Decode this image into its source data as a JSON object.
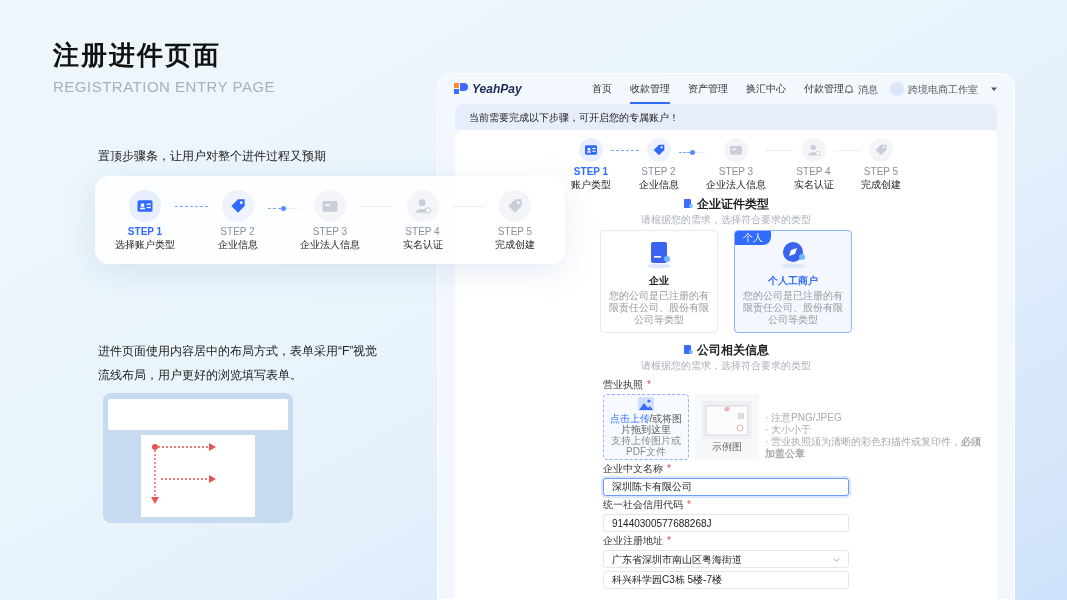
{
  "slide": {
    "title": "注册进件页面",
    "subtitle": "REGISTRATION ENTRY PAGE",
    "note_1": "置顶步骤条，让用户对整个进件过程又预期",
    "note_2": "进件页面使用内容居中的布局方式，表单采用“F”视觉流线布局，用户更好的浏览填写表单。"
  },
  "step_card": {
    "steps": [
      {
        "step": "STEP 1",
        "label": "选择账户类型",
        "kind": "current"
      },
      {
        "step": "STEP 2",
        "label": "企业信息",
        "kind": "reached"
      },
      {
        "step": "STEP 3",
        "label": "企业法人信息",
        "kind": "pending"
      },
      {
        "step": "STEP 4",
        "label": "实名认证",
        "kind": "pending"
      },
      {
        "step": "STEP 5",
        "label": "完成创建",
        "kind": "pending"
      }
    ]
  },
  "app": {
    "logo": "YeahPay",
    "nav": [
      {
        "label": "首页",
        "selected": false
      },
      {
        "label": "收款管理",
        "selected": true
      },
      {
        "label": "资产管理",
        "selected": false
      },
      {
        "label": "换汇中心",
        "selected": false
      },
      {
        "label": "付款管理",
        "selected": false
      }
    ],
    "notifications": "消息",
    "account": "跨境电商工作室",
    "banner": "当前需要完成以下步骤，可开启您的专属账户！",
    "steps": [
      {
        "step": "STEP 1",
        "label": "账户类型",
        "kind": "current"
      },
      {
        "step": "STEP 2",
        "label": "企业信息",
        "kind": "reached"
      },
      {
        "step": "STEP 3",
        "label": "企业法人信息",
        "kind": "pending"
      },
      {
        "step": "STEP 4",
        "label": "实名认证",
        "kind": "pending"
      },
      {
        "step": "STEP 5",
        "label": "完成创建",
        "kind": "pending"
      }
    ],
    "type_section": {
      "title": "企业证件类型",
      "subtitle": "请根据您的需求，选择符合要求的类型"
    },
    "types": [
      {
        "title": "企业",
        "description": "您的公司是已注册的有限责任公司、股份有限公司等类型",
        "selected": false
      },
      {
        "badge": "个人",
        "title": "个人工商户",
        "description": "您的公司是已注册的有限责任公司、股份有限公司等类型",
        "selected": true
      }
    ],
    "info_section": {
      "title": "公司相关信息",
      "subtitle": "请根据您的需求，选择符合要求的类型"
    },
    "fields": [
      {
        "kind": "upload",
        "label": "营业执照",
        "required_mark": "*",
        "upload_link": "点击上传",
        "upload_text": "/或将图片拖到这里",
        "upload_hint": "支持上传图片或PDF文件",
        "sample_caption": "示例图",
        "hints": [
          "· 注意PNG/JPEG",
          "· 大小小于",
          "· 营业执照须为清晰的彩色扫描件或复印件，**必须加盖公章**"
        ]
      },
      {
        "kind": "text",
        "label": "企业中文名称",
        "required_mark": "*",
        "value": "深圳陈卡有限公司",
        "focused": true
      },
      {
        "kind": "text",
        "label": "统一社会信用代码",
        "required_mark": "*",
        "value": "91440300577688268J",
        "focused": false
      },
      {
        "kind": "address",
        "label": "企业注册地址",
        "required_mark": "*",
        "region": "广东省深圳市南山区粤海街道",
        "detail": "科兴科学园C3栋 5楼-7楼"
      }
    ]
  }
}
